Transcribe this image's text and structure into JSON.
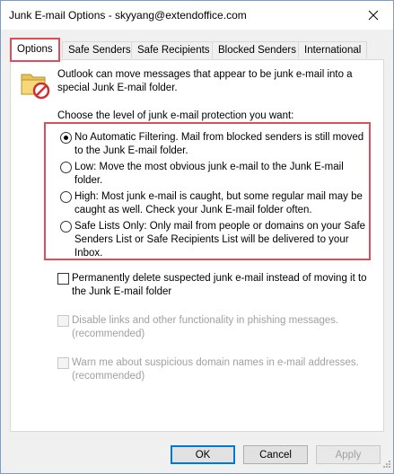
{
  "window": {
    "title": "Junk E-mail Options - skyyang@extendoffice.com",
    "close_glyph": "✕"
  },
  "tabs": [
    {
      "label": "Options",
      "active": true
    },
    {
      "label": "Safe Senders",
      "active": false
    },
    {
      "label": "Safe Recipients",
      "active": false
    },
    {
      "label": "Blocked Senders",
      "active": false
    },
    {
      "label": "International",
      "active": false
    }
  ],
  "options": {
    "intro_text": "Outlook can move messages that appear to be junk e-mail into a special Junk E-mail folder.",
    "choose_label": "Choose the level of junk e-mail protection you want:",
    "levels": [
      {
        "label": "No Automatic Filtering. Mail from blocked senders is still moved to the Junk E-mail folder.",
        "selected": true
      },
      {
        "label": "Low: Move the most obvious junk e-mail to the Junk E-mail folder.",
        "selected": false
      },
      {
        "label": "High: Most junk e-mail is caught, but some regular mail may be caught as well. Check your Junk E-mail folder often.",
        "selected": false
      },
      {
        "label": "Safe Lists Only: Only mail from people or domains on your Safe Senders List or Safe Recipients List will be delivered to your Inbox.",
        "selected": false
      }
    ],
    "checkboxes": [
      {
        "label": "Permanently delete suspected junk e-mail instead of moving it to the Junk E-mail folder",
        "checked": false,
        "enabled": true
      },
      {
        "label": "Disable links and other functionality in phishing messages. (recommended)",
        "checked": false,
        "enabled": false
      },
      {
        "label": "Warn me about suspicious domain names in e-mail addresses. (recommended)",
        "checked": false,
        "enabled": false
      }
    ]
  },
  "buttons": {
    "ok": "OK",
    "cancel": "Cancel",
    "apply": "Apply"
  },
  "colors": {
    "highlight_border": "#d9505c",
    "default_button_border": "#0078d7"
  },
  "icons": {
    "folder": "junk-folder-icon",
    "close": "close-icon"
  }
}
